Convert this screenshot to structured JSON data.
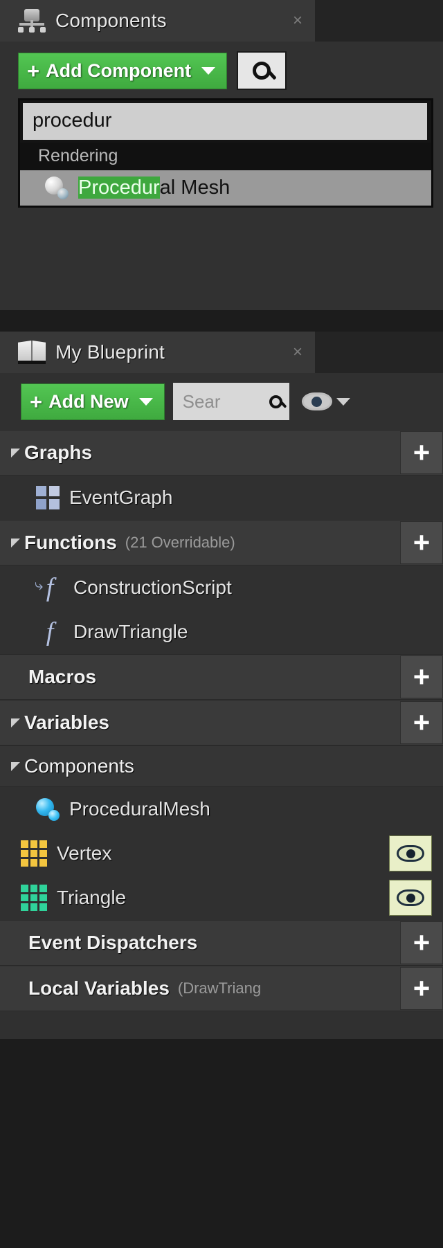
{
  "components_panel": {
    "tab_title": "Components",
    "tab_icon": "components-icon",
    "close_label": "×",
    "add_component": {
      "label": "Add Component",
      "plus": "+",
      "icon": "plus-icon",
      "caret": "chevron-down-icon"
    },
    "search_button_icon": "search-icon",
    "dropdown": {
      "search_value": "procedur",
      "category": "Rendering",
      "item": {
        "match": "Procedur",
        "rest": "al Mesh",
        "icon": "procedural-mesh-icon"
      }
    }
  },
  "myblueprint_panel": {
    "tab_title": "My Blueprint",
    "tab_icon": "blueprint-book-icon",
    "close_label": "×",
    "toolbar": {
      "add_new_label": "Add New",
      "plus": "+",
      "caret": "chevron-down-icon",
      "search_placeholder": "Sear",
      "search_icon": "search-icon",
      "eye_icon": "eye-icon",
      "eye_caret": "chevron-down-icon"
    },
    "sections": [
      {
        "title": "Graphs",
        "subtitle": "",
        "expanded": true,
        "has_add": true,
        "add_label": "+",
        "items": [
          {
            "label": "EventGraph",
            "icon": "event-graph-icon",
            "indent": 1
          }
        ]
      },
      {
        "title": "Functions",
        "subtitle": "(21 Overridable)",
        "expanded": true,
        "has_add": true,
        "add_label": "+",
        "items": [
          {
            "label": "ConstructionScript",
            "icon": "function-override-icon",
            "indent": 1
          },
          {
            "label": "DrawTriangle",
            "icon": "function-icon",
            "indent": 1
          }
        ]
      },
      {
        "title": "Macros",
        "subtitle": "",
        "expanded": false,
        "has_add": true,
        "add_label": "+",
        "items": []
      },
      {
        "title": "Variables",
        "subtitle": "",
        "expanded": true,
        "has_add": true,
        "add_label": "+",
        "items": []
      }
    ],
    "components_subsection": {
      "title": "Components",
      "expanded": true,
      "items": [
        {
          "label": "ProceduralMesh",
          "icon": "procedural-mesh-icon",
          "eye": false
        },
        {
          "label": "Vertex",
          "icon": "vector-array-icon",
          "eye": true,
          "eye_icon": "eye-icon"
        },
        {
          "label": "Triangle",
          "icon": "integer-array-icon",
          "eye": true,
          "eye_icon": "eye-icon"
        }
      ]
    },
    "bottom_sections": [
      {
        "title": "Event Dispatchers",
        "subtitle": "",
        "has_add": true,
        "add_label": "+"
      },
      {
        "title": "Local Variables",
        "subtitle": "(DrawTriang",
        "has_add": true,
        "add_label": "+"
      }
    ]
  },
  "colors": {
    "accent_green": "#4cbb4c",
    "highlight_green": "#3ea83e",
    "panel_bg": "#303030",
    "section_bg": "#3a3a3a",
    "vertex_icon": "#f3c53f",
    "triangle_icon": "#2fd39a",
    "mesh_icon": "#35b9f0"
  }
}
